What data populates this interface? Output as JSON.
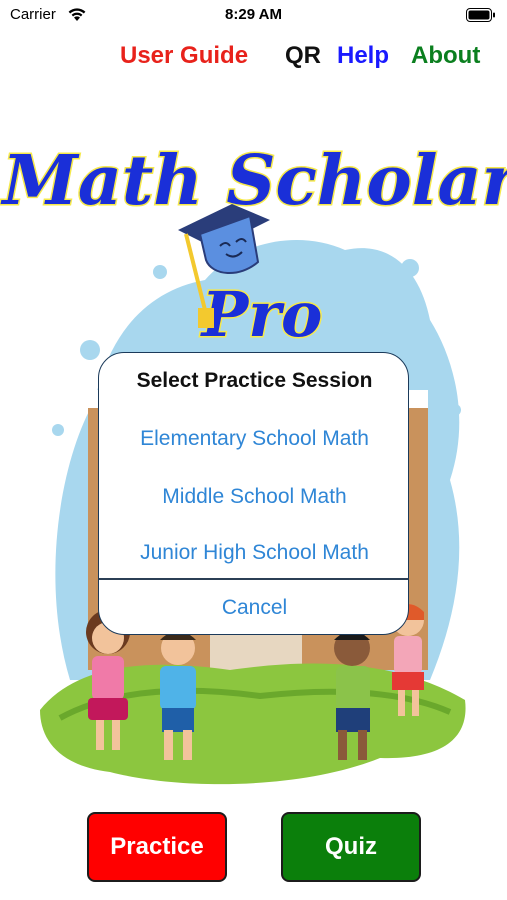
{
  "status_bar": {
    "carrier": "Carrier",
    "time": "8:29 AM",
    "icons": [
      "wifi-icon",
      "battery-icon"
    ]
  },
  "nav": {
    "user_guide": "User Guide",
    "qr": "QR",
    "help": "Help",
    "about": "About"
  },
  "hero": {
    "logo_line1": "Math Scholar",
    "logo_line2": "Pro"
  },
  "action_sheet": {
    "title": "Select Practice Session",
    "options": [
      "Elementary School Math",
      "Middle School Math",
      "Junior High School Math"
    ],
    "cancel": "Cancel"
  },
  "buttons": {
    "practice": "Practice",
    "quiz": "Quiz"
  },
  "colors": {
    "user_guide": "#e8221b",
    "help": "#1a1aff",
    "about": "#0b7f1f",
    "practice": "#ff0000",
    "quiz": "#0b7f0b",
    "option_text": "#2f86d6"
  }
}
